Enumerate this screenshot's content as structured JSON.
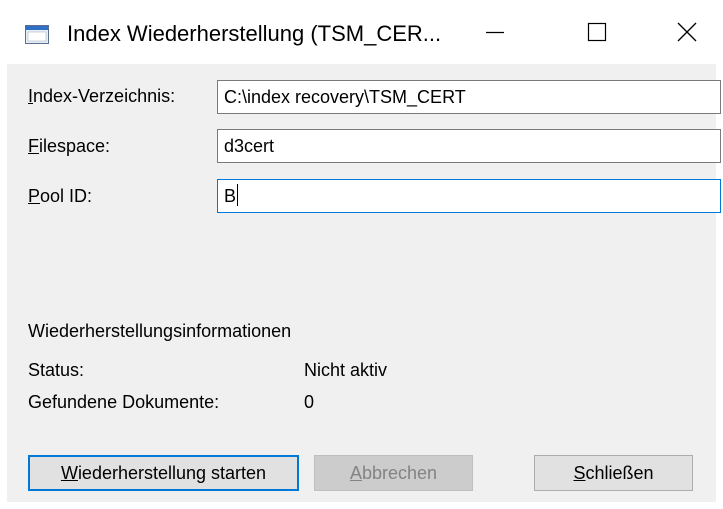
{
  "window": {
    "title": "Index Wiederherstellung (TSM_CER...",
    "minimize_icon": "minimize-icon",
    "maximize_icon": "maximize-icon",
    "close_icon": "close-icon"
  },
  "form": {
    "index_dir": {
      "label_accel": "I",
      "label_rest": "ndex-Verzeichnis:",
      "value": "C:\\index recovery\\TSM_CERT"
    },
    "filespace": {
      "label_accel": "F",
      "label_rest": "ilespace:",
      "value": "d3cert"
    },
    "pool_id": {
      "label_accel": "P",
      "label_rest": "ool ID:",
      "value": "B"
    }
  },
  "info": {
    "heading": "Wiederherstellungsinformationen",
    "status_label": "Status:",
    "status_value": "Nicht aktiv",
    "docs_label": "Gefundene Dokumente:",
    "docs_value": "0"
  },
  "buttons": {
    "start": {
      "accel": "W",
      "rest": "iederherstellung starten"
    },
    "cancel": {
      "accel": "A",
      "rest": "bbrechen"
    },
    "close": {
      "accel": "S",
      "rest": "chließen"
    }
  }
}
